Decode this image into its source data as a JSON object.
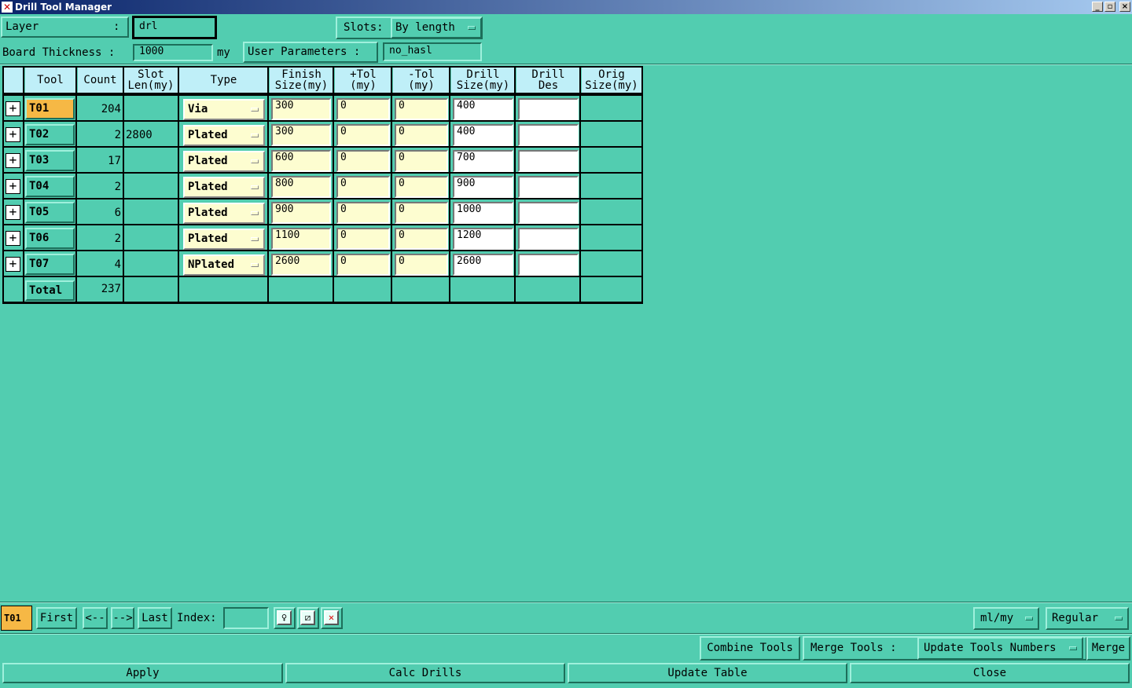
{
  "window": {
    "title": "Drill Tool Manager"
  },
  "top": {
    "layer_label": "Layer",
    "layer_colon": ":",
    "layer_value": "drl",
    "slots_label": "Slots:",
    "slots_value": "By length",
    "thickness_label": "Board Thickness :",
    "thickness_value": "1000",
    "thickness_unit": "my",
    "user_params_label": "User Parameters :",
    "user_params_value": "no_hasl"
  },
  "table": {
    "headers": [
      {
        "l1": "Tool",
        "l2": ""
      },
      {
        "l1": "Count",
        "l2": ""
      },
      {
        "l1": "Slot",
        "l2": "Len(my)"
      },
      {
        "l1": "Type",
        "l2": ""
      },
      {
        "l1": "Finish",
        "l2": "Size(my)"
      },
      {
        "l1": "+Tol",
        "l2": "(my)"
      },
      {
        "l1": "-Tol",
        "l2": "(my)"
      },
      {
        "l1": "Drill",
        "l2": "Size(my)"
      },
      {
        "l1": "Drill",
        "l2": "Des"
      },
      {
        "l1": "Orig",
        "l2": "Size(my)"
      }
    ],
    "rows": [
      {
        "tool": "T01",
        "count": "204",
        "slot": "",
        "type": "Via",
        "finish": "300",
        "ptol": "0",
        "mtol": "0",
        "drill": "400",
        "des": "",
        "orig": ""
      },
      {
        "tool": "T02",
        "count": "2",
        "slot": "2800",
        "type": "Plated",
        "finish": "300",
        "ptol": "0",
        "mtol": "0",
        "drill": "400",
        "des": "",
        "orig": ""
      },
      {
        "tool": "T03",
        "count": "17",
        "slot": "",
        "type": "Plated",
        "finish": "600",
        "ptol": "0",
        "mtol": "0",
        "drill": "700",
        "des": "",
        "orig": ""
      },
      {
        "tool": "T04",
        "count": "2",
        "slot": "",
        "type": "Plated",
        "finish": "800",
        "ptol": "0",
        "mtol": "0",
        "drill": "900",
        "des": "",
        "orig": ""
      },
      {
        "tool": "T05",
        "count": "6",
        "slot": "",
        "type": "Plated",
        "finish": "900",
        "ptol": "0",
        "mtol": "0",
        "drill": "1000",
        "des": "",
        "orig": ""
      },
      {
        "tool": "T06",
        "count": "2",
        "slot": "",
        "type": "Plated",
        "finish": "1100",
        "ptol": "0",
        "mtol": "0",
        "drill": "1200",
        "des": "",
        "orig": ""
      },
      {
        "tool": "T07",
        "count": "4",
        "slot": "",
        "type": "NPlated",
        "finish": "2600",
        "ptol": "0",
        "mtol": "0",
        "drill": "2600",
        "des": "",
        "orig": ""
      }
    ],
    "total_label": "Total",
    "total_count": "237",
    "selected_tool": "T01"
  },
  "nav": {
    "current": "T01",
    "first": "First",
    "prev": "<--",
    "next": "-->",
    "last": "Last",
    "index_label": "Index:",
    "index_value": "",
    "units": "ml/my",
    "mode": "Regular"
  },
  "merge": {
    "combine": "Combine Tools",
    "merge_label": "Merge Tools :",
    "merge_option": "Update Tools Numbers",
    "merge_btn": "Merge"
  },
  "actions": {
    "apply": "Apply",
    "calc": "Calc Drills",
    "update": "Update Table",
    "close": "Close"
  }
}
